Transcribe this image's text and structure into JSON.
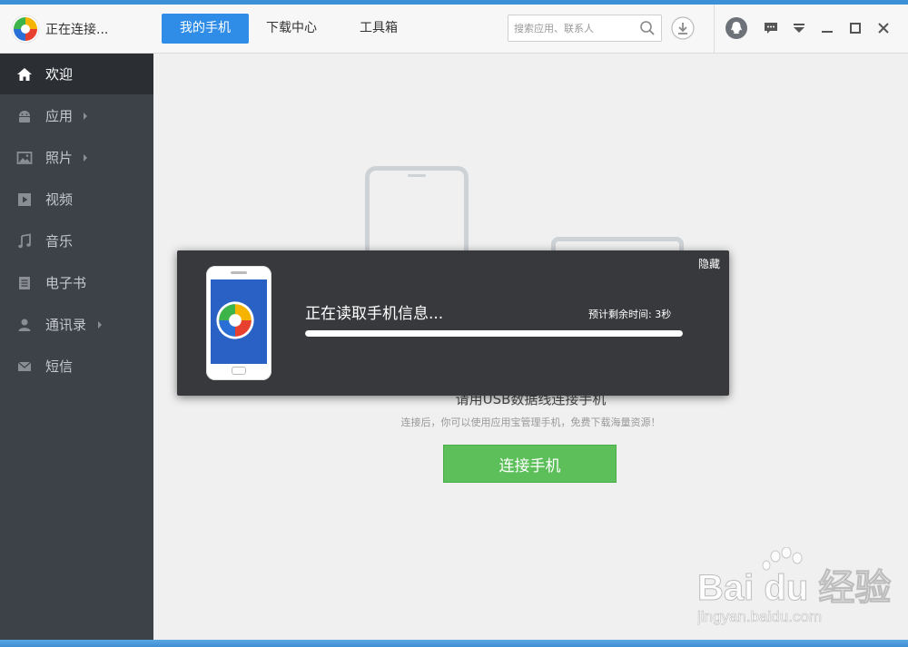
{
  "app": {
    "title": "正在连接..."
  },
  "tabs": [
    {
      "label": "我的手机",
      "active": true
    },
    {
      "label": "下载中心",
      "active": false
    },
    {
      "label": "工具箱",
      "active": false
    }
  ],
  "search": {
    "placeholder": "搜索应用、联系人"
  },
  "toolbar_icons": [
    "download-icon",
    "qq-icon",
    "message-icon",
    "dropdown-icon",
    "minimize-icon",
    "maximize-icon",
    "close-icon"
  ],
  "sidebar": {
    "items": [
      {
        "label": "欢迎",
        "icon": "home-icon",
        "active": true,
        "arrow": false
      },
      {
        "label": "应用",
        "icon": "android-icon",
        "active": false,
        "arrow": true
      },
      {
        "label": "照片",
        "icon": "photo-icon",
        "active": false,
        "arrow": true
      },
      {
        "label": "视频",
        "icon": "video-icon",
        "active": false,
        "arrow": false
      },
      {
        "label": "音乐",
        "icon": "music-icon",
        "active": false,
        "arrow": false
      },
      {
        "label": "电子书",
        "icon": "ebook-icon",
        "active": false,
        "arrow": false
      },
      {
        "label": "通讯录",
        "icon": "contacts-icon",
        "active": false,
        "arrow": true
      },
      {
        "label": "短信",
        "icon": "sms-icon",
        "active": false,
        "arrow": false
      }
    ]
  },
  "main": {
    "hint_title": "请用USB数据线连接手机",
    "hint_sub": "连接后，你可以使用应用宝管理手机，免费下载海量资源！",
    "connect_button": "连接手机"
  },
  "dialog": {
    "hide_label": "隐藏",
    "status": "正在读取手机信息...",
    "eta_label": "预计剩余时间:",
    "eta_value": "3秒",
    "progress_fraction": 1.0
  },
  "watermark": {
    "brand": "Bai du 经验",
    "url": "jingyan.baidu.com"
  },
  "colors": {
    "accent": "#2f8de8",
    "sidebar": "#3d4148",
    "connect": "#5cbf5a",
    "dialog": "#38393c"
  }
}
